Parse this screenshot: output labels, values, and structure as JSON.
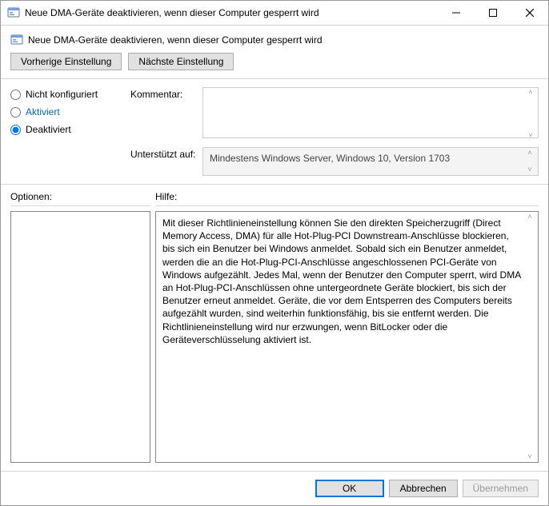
{
  "window": {
    "title": "Neue DMA-Geräte deaktivieren, wenn dieser Computer gesperrt wird"
  },
  "header": {
    "subtitle": "Neue DMA-Geräte deaktivieren, wenn dieser Computer gesperrt wird"
  },
  "nav": {
    "prev": "Vorherige Einstellung",
    "next": "Nächste Einstellung"
  },
  "state": {
    "options": [
      {
        "id": "not_configured",
        "label": "Nicht konfiguriert",
        "checked": false
      },
      {
        "id": "activated",
        "label": "Aktiviert",
        "checked": false
      },
      {
        "id": "deactivated",
        "label": "Deaktiviert",
        "checked": true
      }
    ]
  },
  "fields": {
    "comment_label": "Kommentar:",
    "comment_value": "",
    "support_label": "Unterstützt auf:",
    "support_value": "Mindestens Windows Server, Windows 10, Version 1703"
  },
  "panels": {
    "options_label": "Optionen:",
    "help_label": "Hilfe:",
    "help_text": "Mit dieser Richtlinieneinstellung können Sie den direkten Speicherzugriff (Direct Memory Access, DMA) für alle Hot-Plug-PCI Downstream-Anschlüsse blockieren, bis sich ein Benutzer bei Windows anmeldet. Sobald sich ein Benutzer anmeldet, werden die an die Hot-Plug-PCI-Anschlüsse angeschlossenen PCI-Geräte von Windows aufgezählt. Jedes Mal, wenn der Benutzer den Computer sperrt, wird DMA an Hot-Plug-PCI-Anschlüssen ohne untergeordnete Geräte blockiert, bis sich der Benutzer erneut anmeldet. Geräte, die vor dem Entsperren des Computers bereits aufgezählt wurden, sind weiterhin funktionsfähig, bis sie entfernt werden. Die Richtlinieneinstellung wird nur erzwungen, wenn BitLocker oder die Geräteverschlüsselung aktiviert ist."
  },
  "footer": {
    "ok": "OK",
    "cancel": "Abbrechen",
    "apply": "Übernehmen"
  },
  "colors": {
    "accent": "#0078d7"
  }
}
